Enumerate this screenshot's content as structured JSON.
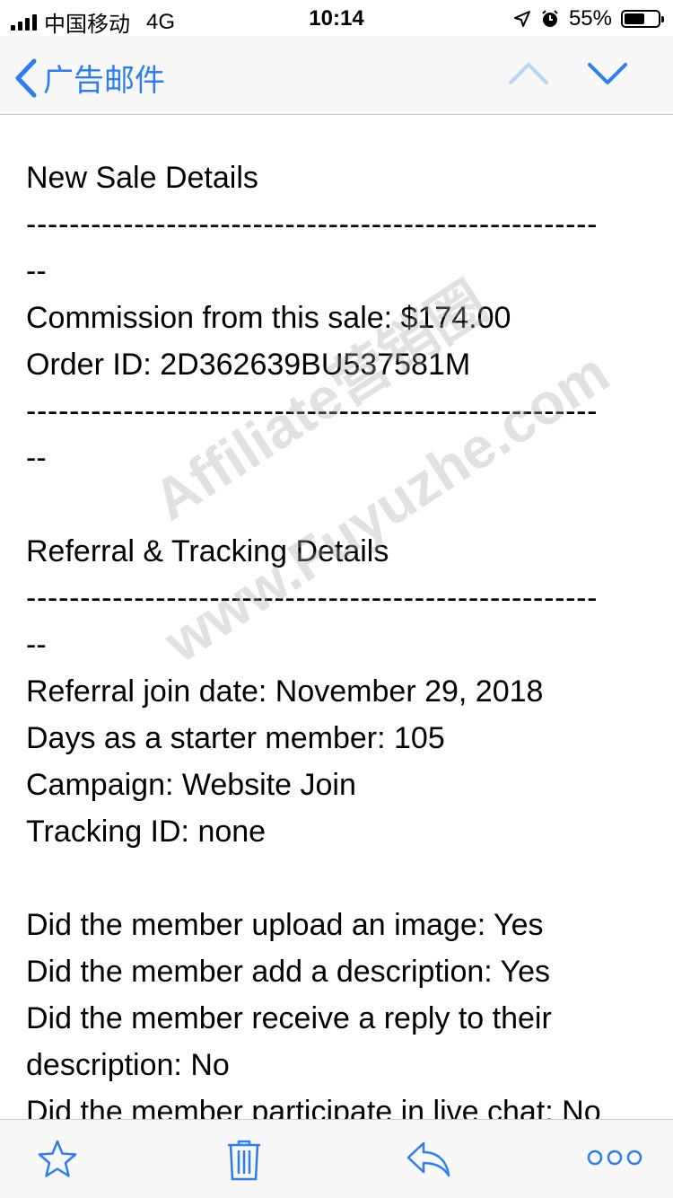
{
  "status_bar": {
    "carrier": "中国移动",
    "network": "4G",
    "time": "10:14",
    "battery": "55%",
    "battery_level": 0.55
  },
  "nav": {
    "back_label": "广告邮件",
    "accent": "#2a7df6"
  },
  "email": {
    "lines": [
      "New Sale Details",
      "-----------------------------------------------------",
      "--",
      "Commission from this sale: $174.00",
      "Order ID: 2D362639BU537581M",
      "-----------------------------------------------------",
      "--",
      "",
      "Referral & Tracking Details",
      "-----------------------------------------------------",
      "--",
      "Referral join date: November 29, 2018",
      "Days as a starter member: 105",
      "Campaign: Website Join",
      "Tracking ID: none",
      "",
      "Did the member upload an image: Yes",
      "Did the member add a description: Yes",
      "Did the member receive a reply to their description: No",
      "Did the member participate in live chat: No"
    ]
  },
  "watermark": {
    "line1": "Affiliate营销圈",
    "line2": "www.Fuyuzhe.com"
  },
  "toolbar": {
    "icons": [
      "star-icon",
      "trash-icon",
      "reply-icon",
      "more-icon"
    ]
  }
}
